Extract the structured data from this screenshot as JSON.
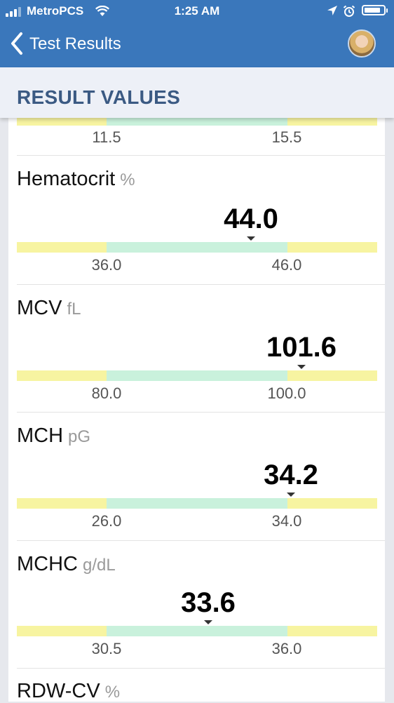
{
  "status_bar": {
    "carrier": "MetroPCS",
    "time": "1:25 AM"
  },
  "nav": {
    "title": "Test Results",
    "back_icon": "chevron-left-icon",
    "avatar_icon": "user-avatar"
  },
  "section": {
    "title": "RESULT VALUES"
  },
  "prev_row": {
    "low": "11.5",
    "high": "15.5"
  },
  "results": [
    {
      "name": "Hematocrit",
      "unit": "%",
      "value": "44.0",
      "low": "36.0",
      "high": "46.0"
    },
    {
      "name": "MCV",
      "unit": "fL",
      "value": "101.6",
      "low": "80.0",
      "high": "100.0"
    },
    {
      "name": "MCH",
      "unit": "pG",
      "value": "34.2",
      "low": "26.0",
      "high": "34.0"
    },
    {
      "name": "MCHC",
      "unit": "g/dL",
      "value": "33.6",
      "low": "30.5",
      "high": "36.0"
    },
    {
      "name": "RDW-CV",
      "unit": "%"
    }
  ],
  "colors": {
    "nav_bg": "#3a77bb",
    "section_title": "#3b5a83",
    "range_normal": "#c9f1dc",
    "range_out": "#f7f4a1"
  }
}
